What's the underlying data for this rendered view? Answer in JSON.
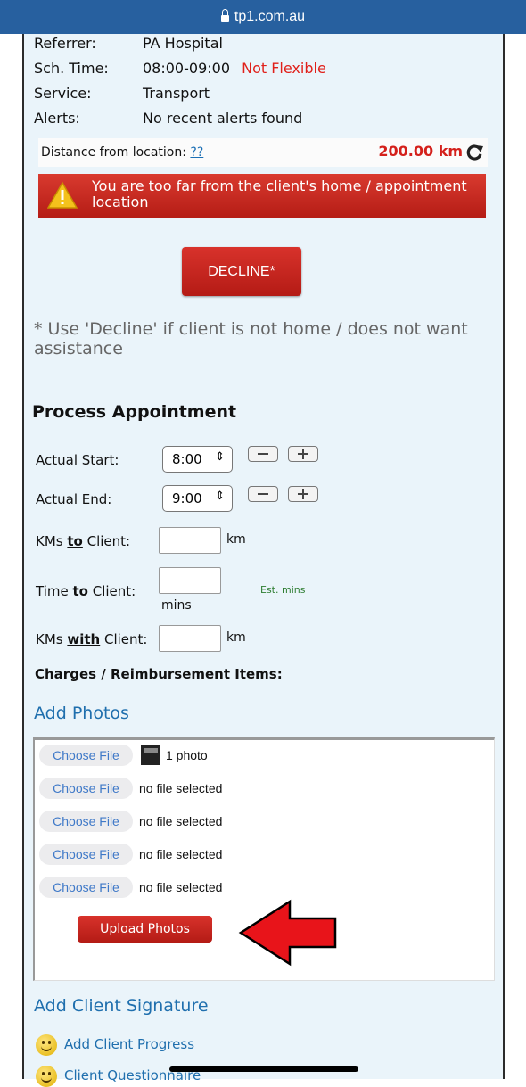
{
  "browser": {
    "url": "tp1.com.au"
  },
  "details": [
    {
      "label": "Referrer:",
      "value": "PA Hospital"
    },
    {
      "label": "Sch. Time:",
      "value": "08:00-09:00",
      "note": "Not Flexible"
    },
    {
      "label": "Service:",
      "value": "Transport"
    },
    {
      "label": "Alerts:",
      "value": "No recent alerts found"
    }
  ],
  "distance": {
    "label": "Distance from location:",
    "help_link": "??",
    "value": "200.00 km"
  },
  "alert": {
    "message": "You are too far from the client's home / appointment location"
  },
  "decline": {
    "button": "DECLINE*",
    "note": "* Use 'Decline' if client is not home / does not want assistance"
  },
  "process": {
    "title": "Process Appointment",
    "actual_start": {
      "label": "Actual Start:",
      "value": "8:00"
    },
    "actual_end": {
      "label": "Actual End:",
      "value": "9:00"
    },
    "kms_to": {
      "pre": "KMs ",
      "em": "to",
      "post": " Client:",
      "unit": "km"
    },
    "time_to": {
      "pre": "Time ",
      "em": "to",
      "post": " Client:",
      "unit": "mins",
      "hint": "Est. mins"
    },
    "kms_with": {
      "pre": "KMs ",
      "em": "with",
      "post": " Client:",
      "unit": "km"
    },
    "charges_label": "Charges / Reimbursement Items:"
  },
  "photos": {
    "title": "Add Photos",
    "choose_label": "Choose File",
    "files": [
      "1 photo",
      "no file selected",
      "no file selected",
      "no file selected",
      "no file selected"
    ],
    "upload_button": "Upload Photos"
  },
  "signature": {
    "title": "Add Client Signature"
  },
  "links": [
    "Add Client Progress",
    "Client Questionnaire"
  ],
  "colors": {
    "topbar": "#27609f",
    "page_bg": "#eaf4fa",
    "accent_red": "#d4201b",
    "link_blue": "#1f6fae"
  }
}
